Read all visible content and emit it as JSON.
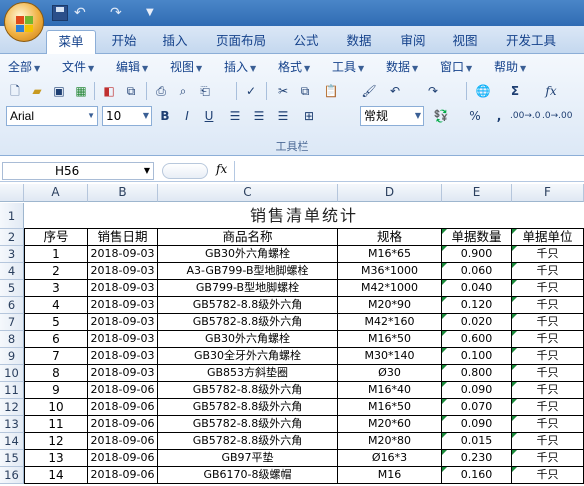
{
  "menubar": [
    "全部",
    "文件",
    "编辑",
    "视图",
    "插入",
    "格式",
    "工具",
    "数据",
    "窗口",
    "帮助"
  ],
  "tabs": [
    "菜单",
    "开始",
    "插入",
    "页面布局",
    "公式",
    "数据",
    "审阅",
    "视图",
    "开发工具"
  ],
  "active_tab": "菜单",
  "toolbar": {
    "font": "Arial",
    "font_size": "10",
    "number_format": "常规",
    "bold": "B",
    "italic": "I",
    "underline": "U",
    "sigma": "Σ",
    "fx": "fx",
    "percent": "%",
    "comma": ",",
    "inc_decimal": ".00→.0",
    "dec_decimal": ".0→.00",
    "group_label": "工具栏"
  },
  "formula_bar": {
    "name_box": "H56",
    "fx_label": "fx",
    "value": ""
  },
  "columns": [
    "A",
    "B",
    "C",
    "D",
    "E",
    "F"
  ],
  "row_numbers": [
    "1",
    "2",
    "3",
    "4",
    "5",
    "6",
    "7",
    "8",
    "9",
    "10",
    "11",
    "12",
    "13",
    "14",
    "15",
    "16"
  ],
  "sheet": {
    "title": "销售清单统计",
    "headers": [
      "序号",
      "销售日期",
      "商品名称",
      "规格",
      "单据数量",
      "单据单位"
    ],
    "rows": [
      [
        "1",
        "2018-09-03",
        "GB30外六角螺栓",
        "M16*65",
        "0.900",
        "千只"
      ],
      [
        "2",
        "2018-09-03",
        "A3-GB799-B型地脚螺栓",
        "M36*1000",
        "0.060",
        "千只"
      ],
      [
        "3",
        "2018-09-03",
        "GB799-B型地脚螺栓",
        "M42*1000",
        "0.040",
        "千只"
      ],
      [
        "4",
        "2018-09-03",
        "GB5782-8.8级外六角",
        "M20*90",
        "0.120",
        "千只"
      ],
      [
        "5",
        "2018-09-03",
        "GB5782-8.8级外六角",
        "M42*160",
        "0.020",
        "千只"
      ],
      [
        "6",
        "2018-09-03",
        "GB30外六角螺栓",
        "M16*50",
        "0.600",
        "千只"
      ],
      [
        "7",
        "2018-09-03",
        "GB30全牙外六角螺栓",
        "M30*140",
        "0.100",
        "千只"
      ],
      [
        "8",
        "2018-09-03",
        "GB853方斜垫圈",
        "Ø30",
        "0.800",
        "千只"
      ],
      [
        "9",
        "2018-09-06",
        "GB5782-8.8级外六角",
        "M16*40",
        "0.090",
        "千只"
      ],
      [
        "10",
        "2018-09-06",
        "GB5782-8.8级外六角",
        "M16*50",
        "0.070",
        "千只"
      ],
      [
        "11",
        "2018-09-06",
        "GB5782-8.8级外六角",
        "M20*60",
        "0.090",
        "千只"
      ],
      [
        "12",
        "2018-09-06",
        "GB5782-8.8级外六角",
        "M20*80",
        "0.015",
        "千只"
      ],
      [
        "13",
        "2018-09-06",
        "GB97平垫",
        "Ø16*3",
        "0.230",
        "千只"
      ],
      [
        "14",
        "2018-09-06",
        "GB6170-8级螺帽",
        "M16",
        "0.160",
        "千只"
      ]
    ]
  },
  "colors": {
    "header_blue": "#15428b",
    "ribbon_border": "#8caed7",
    "error_triangle": "#1a8a3a"
  }
}
